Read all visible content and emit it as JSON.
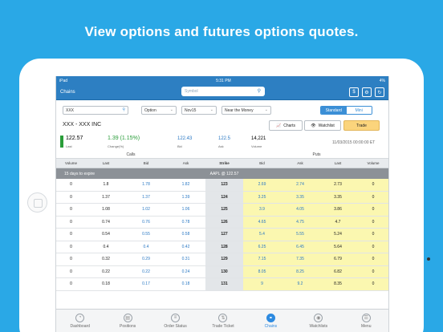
{
  "headline": "View options and futures options quotes.",
  "status_bar": {
    "device": "iPad",
    "time": "5:31 PM",
    "battery": "4%"
  },
  "nav": {
    "title": "Chains",
    "search_placeholder": "Symbol"
  },
  "controls": {
    "symbol_value": "XXX",
    "option_select": "Option",
    "expiry_select": "Nov15",
    "strike_filter": "Near the Money",
    "mode_standard": "Standard",
    "mode_mini": "Mini"
  },
  "quote": {
    "company": "XXX - XXX INC",
    "last": "122.57",
    "last_label": "Last",
    "change": "1.39 (1.15%)",
    "change_label": "Change(%)",
    "bid": "122.43",
    "bid_label": "Bid",
    "ask": "122.5",
    "ask_label": "Ask",
    "volume": "14,221",
    "volume_label": "Volume",
    "timestamp": "11/03/2015 00:00:00 ET"
  },
  "buttons": {
    "charts": "Charts",
    "watchlist": "Watchlist",
    "trade": "Trade"
  },
  "table": {
    "calls_label": "Calls",
    "puts_label": "Puts",
    "headers": [
      "Volume",
      "Last",
      "Bid",
      "Ask",
      "Strike",
      "Bid",
      "Ask",
      "Last",
      "Volume"
    ],
    "expiry_text": "15 days to expire",
    "underlying": "AAPL @ 122.57",
    "rows": [
      [
        "0",
        "1.8",
        "1.78",
        "1.82",
        "123",
        "2.69",
        "2.74",
        "2.73",
        "0"
      ],
      [
        "0",
        "1.37",
        "1.37",
        "1.39",
        "124",
        "3.25",
        "3.35",
        "3.35",
        "0"
      ],
      [
        "0",
        "1.08",
        "1.02",
        "1.06",
        "125",
        "3.9",
        "4.05",
        "3.86",
        "0"
      ],
      [
        "0",
        "0.74",
        "0.76",
        "0.78",
        "126",
        "4.65",
        "4.75",
        "4.7",
        "0"
      ],
      [
        "0",
        "0.54",
        "0.55",
        "0.58",
        "127",
        "5.4",
        "5.55",
        "5.24",
        "0"
      ],
      [
        "0",
        "0.4",
        "0.4",
        "0.42",
        "128",
        "6.25",
        "6.45",
        "5.64",
        "0"
      ],
      [
        "0",
        "0.32",
        "0.29",
        "0.31",
        "129",
        "7.15",
        "7.35",
        "6.79",
        "0"
      ],
      [
        "0",
        "0.22",
        "0.22",
        "0.24",
        "130",
        "8.05",
        "8.25",
        "6.82",
        "0"
      ],
      [
        "0",
        "0.18",
        "0.17",
        "0.18",
        "131",
        "9",
        "9.2",
        "8.35",
        "0"
      ]
    ]
  },
  "tabs": [
    "Dashboard",
    "Positions",
    "Order Status",
    "Trade Ticket",
    "Chains",
    "Watchlists",
    "Menu"
  ],
  "colors": {
    "background": "#2aa8e6",
    "nav": "#2d7fc2",
    "positive": "#2a9d3a",
    "bid_ask": "#2a78c4",
    "puts_fill": "#fbf7b0",
    "trade_button": "#fbd47c"
  }
}
